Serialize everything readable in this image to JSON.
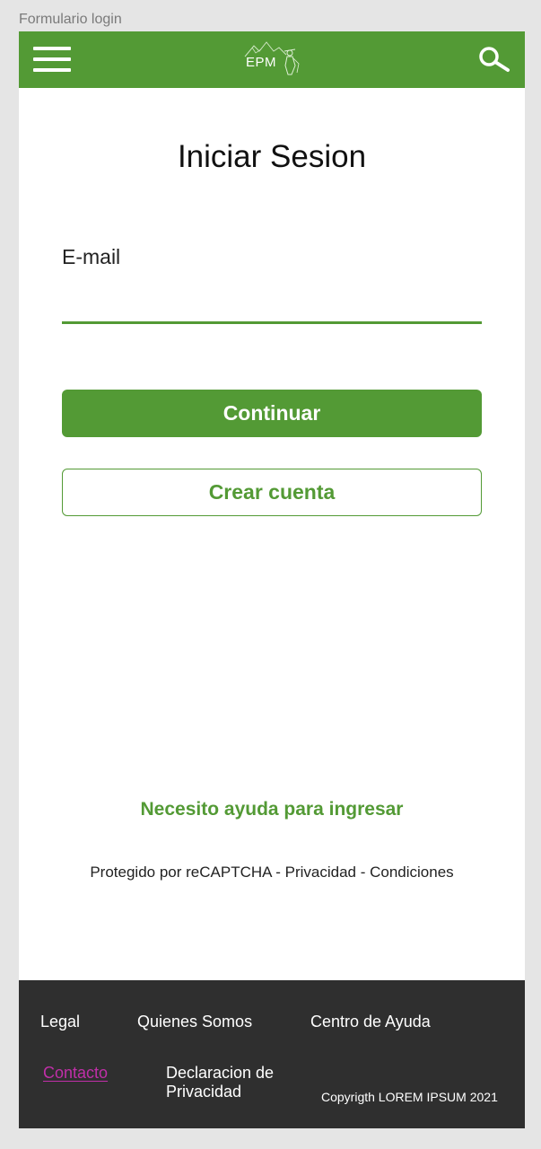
{
  "frame": {
    "label": "Formulario login"
  },
  "header": {
    "menu_icon": "hamburger-menu-icon",
    "logo_text": "EPM",
    "search_icon": "search-icon",
    "background_color": "#539a35"
  },
  "login": {
    "title": "Iniciar Sesion",
    "email_label": "E-mail",
    "email_value": "",
    "continue_label": "Continuar",
    "create_account_label": "Crear cuenta",
    "help_link": "Necesito ayuda para ingresar",
    "recaptcha_text": "Protegido por reCAPTCHA - Privacidad - Condiciones",
    "accent_color": "#539a35"
  },
  "footer": {
    "links": {
      "legal": "Legal",
      "quienes_somos": "Quienes Somos",
      "centro_ayuda": "Centro de Ayuda",
      "contacto": "Contacto",
      "declaracion_line1": "Declaracion de",
      "declaracion_line2": "Privacidad"
    },
    "copyright": "Copyrigth LOREM IPSUM 2021",
    "background_color": "#2f2f2f",
    "contact_color": "#c02fa8"
  }
}
